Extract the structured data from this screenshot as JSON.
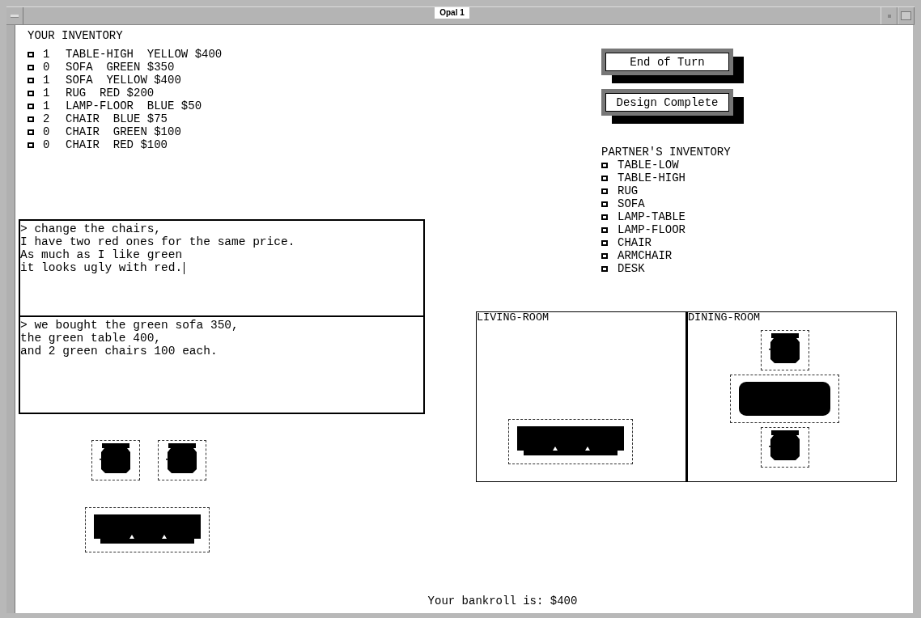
{
  "window": {
    "title": "Opal 1"
  },
  "your_inventory": {
    "title": "YOUR INVENTORY",
    "items": [
      {
        "count": "1",
        "description": "TABLE-HIGH  YELLOW $400"
      },
      {
        "count": "0",
        "description": "SOFA  GREEN $350"
      },
      {
        "count": "1",
        "description": "SOFA  YELLOW $400"
      },
      {
        "count": "1",
        "description": "RUG  RED $200"
      },
      {
        "count": "1",
        "description": "LAMP-FLOOR  BLUE $50"
      },
      {
        "count": "2",
        "description": "CHAIR  BLUE $75"
      },
      {
        "count": "0",
        "description": "CHAIR  GREEN $100"
      },
      {
        "count": "0",
        "description": "CHAIR  RED $100"
      }
    ]
  },
  "messages": [
    {
      "lines": [
        "> change the chairs,",
        "I have two red ones for the same price.",
        "As much as I like green",
        "it looks ugly with red."
      ],
      "focused": true
    },
    {
      "lines": [
        "> we bought the green sofa 350,",
        "the green table 400,",
        "and 2 green chairs 100 each."
      ],
      "focused": false
    }
  ],
  "buttons": [
    "End of Turn",
    "Design Complete"
  ],
  "partner_inventory": {
    "title": "PARTNER'S INVENTORY",
    "items": [
      "TABLE-LOW",
      "TABLE-HIGH",
      "RUG",
      "SOFA",
      "LAMP-TABLE",
      "LAMP-FLOOR",
      "CHAIR",
      "ARMCHAIR",
      "DESK"
    ]
  },
  "rooms": [
    {
      "name": "LIVING-ROOM",
      "kind": "living",
      "furniture": [
        {
          "kind": "sofa"
        }
      ]
    },
    {
      "name": "DINING-ROOM",
      "kind": "dining",
      "furniture": [
        {
          "kind": "chair"
        },
        {
          "kind": "table"
        },
        {
          "kind": "chair"
        }
      ]
    }
  ],
  "loose_furniture": [
    {
      "kind": "chair"
    },
    {
      "kind": "chair"
    },
    {
      "kind": "sofa"
    }
  ],
  "status": "Your bankroll is: $400"
}
